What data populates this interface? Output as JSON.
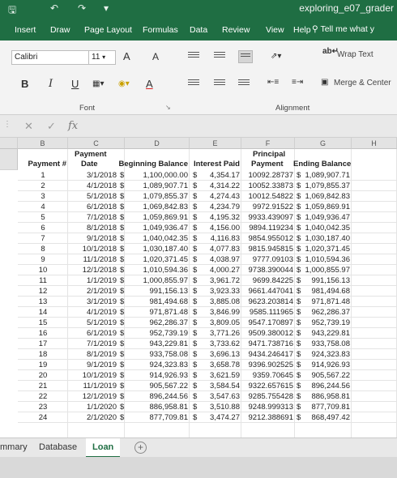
{
  "window": {
    "doc_title": "exploring_e07_grader",
    "save_icon": "save-icon",
    "undo_icon": "undo-icon",
    "redo_icon": "redo-icon"
  },
  "ribbon_tabs": [
    "Insert",
    "Draw",
    "Page Layout",
    "Formulas",
    "Data",
    "Review",
    "View",
    "Help"
  ],
  "tell_me": "Tell me what y",
  "ribbon": {
    "font_name": "Calibri",
    "font_size": "11",
    "grow_font": "A",
    "shrink_font": "A",
    "bold": "B",
    "italic": "I",
    "underline": "U",
    "font_color": "A",
    "wrap_text": "Wrap Text",
    "merge_center": "Merge & Center",
    "font_group": "Font",
    "alignment_group": "Alignment"
  },
  "formula_bar": {
    "fx": "fx",
    "cancel": "✕",
    "enter": "✓"
  },
  "columns": [
    "B",
    "C",
    "D",
    "E",
    "F",
    "G",
    "H"
  ],
  "headers": {
    "payment_num": "Payment #",
    "payment_date_1": "Payment",
    "payment_date_2": "Date",
    "beginning_balance": "Beginning Balance",
    "interest_paid": "Interest Paid",
    "principal_1": "Principal",
    "principal_2": "Payment",
    "ending_balance": "Ending Balance"
  },
  "rows": [
    {
      "n": "1",
      "date": "3/1/2018",
      "bb": "1,100,000.00",
      "ip": "4,354.17",
      "pp": "10092.28737",
      "eb": "1,089,907.71"
    },
    {
      "n": "2",
      "date": "4/1/2018",
      "bb": "1,089,907.71",
      "ip": "4,314.22",
      "pp": "10052.33873",
      "eb": "1,079,855.37"
    },
    {
      "n": "3",
      "date": "5/1/2018",
      "bb": "1,079,855.37",
      "ip": "4,274.43",
      "pp": "10012.54822",
      "eb": "1,069,842.83"
    },
    {
      "n": "4",
      "date": "6/1/2018",
      "bb": "1,069,842.83",
      "ip": "4,234.79",
      "pp": "9972.91522",
      "eb": "1,059,869.91"
    },
    {
      "n": "5",
      "date": "7/1/2018",
      "bb": "1,059,869.91",
      "ip": "4,195.32",
      "pp": "9933.439097",
      "eb": "1,049,936.47"
    },
    {
      "n": "6",
      "date": "8/1/2018",
      "bb": "1,049,936.47",
      "ip": "4,156.00",
      "pp": "9894.119234",
      "eb": "1,040,042.35"
    },
    {
      "n": "7",
      "date": "9/1/2018",
      "bb": "1,040,042.35",
      "ip": "4,116.83",
      "pp": "9854.955012",
      "eb": "1,030,187.40"
    },
    {
      "n": "8",
      "date": "10/1/2018",
      "bb": "1,030,187.40",
      "ip": "4,077.83",
      "pp": "9815.945815",
      "eb": "1,020,371.45"
    },
    {
      "n": "9",
      "date": "11/1/2018",
      "bb": "1,020,371.45",
      "ip": "4,038.97",
      "pp": "9777.09103",
      "eb": "1,010,594.36"
    },
    {
      "n": "10",
      "date": "12/1/2018",
      "bb": "1,010,594.36",
      "ip": "4,000.27",
      "pp": "9738.390044",
      "eb": "1,000,855.97"
    },
    {
      "n": "11",
      "date": "1/1/2019",
      "bb": "1,000,855.97",
      "ip": "3,961.72",
      "pp": "9699.84225",
      "eb": "991,156.13"
    },
    {
      "n": "12",
      "date": "2/1/2019",
      "bb": "991,156.13",
      "ip": "3,923.33",
      "pp": "9661.447041",
      "eb": "981,494.68"
    },
    {
      "n": "13",
      "date": "3/1/2019",
      "bb": "981,494.68",
      "ip": "3,885.08",
      "pp": "9623.203814",
      "eb": "971,871.48"
    },
    {
      "n": "14",
      "date": "4/1/2019",
      "bb": "971,871.48",
      "ip": "3,846.99",
      "pp": "9585.111965",
      "eb": "962,286.37"
    },
    {
      "n": "15",
      "date": "5/1/2019",
      "bb": "962,286.37",
      "ip": "3,809.05",
      "pp": "9547.170897",
      "eb": "952,739.19"
    },
    {
      "n": "16",
      "date": "6/1/2019",
      "bb": "952,739.19",
      "ip": "3,771.26",
      "pp": "9509.380012",
      "eb": "943,229.81"
    },
    {
      "n": "17",
      "date": "7/1/2019",
      "bb": "943,229.81",
      "ip": "3,733.62",
      "pp": "9471.738716",
      "eb": "933,758.08"
    },
    {
      "n": "18",
      "date": "8/1/2019",
      "bb": "933,758.08",
      "ip": "3,696.13",
      "pp": "9434.246417",
      "eb": "924,323.83"
    },
    {
      "n": "19",
      "date": "9/1/2019",
      "bb": "924,323.83",
      "ip": "3,658.78",
      "pp": "9396.902525",
      "eb": "914,926.93"
    },
    {
      "n": "20",
      "date": "10/1/2019",
      "bb": "914,926.93",
      "ip": "3,621.59",
      "pp": "9359.70645",
      "eb": "905,567.22"
    },
    {
      "n": "21",
      "date": "11/1/2019",
      "bb": "905,567.22",
      "ip": "3,584.54",
      "pp": "9322.657615",
      "eb": "896,244.56"
    },
    {
      "n": "22",
      "date": "12/1/2019",
      "bb": "896,244.56",
      "ip": "3,547.63",
      "pp": "9285.755428",
      "eb": "886,958.81"
    },
    {
      "n": "23",
      "date": "1/1/2020",
      "bb": "886,958.81",
      "ip": "3,510.88",
      "pp": "9248.999313",
      "eb": "877,709.81"
    },
    {
      "n": "24",
      "date": "2/1/2020",
      "bb": "877,709.81",
      "ip": "3,474.27",
      "pp": "9212.388691",
      "eb": "868,497.42"
    }
  ],
  "currency_symbol": "$",
  "sheet_tabs": [
    "mmary",
    "Database",
    "Loan"
  ],
  "active_sheet": "Loan",
  "colors": {
    "excel_green": "#1f6e43"
  }
}
